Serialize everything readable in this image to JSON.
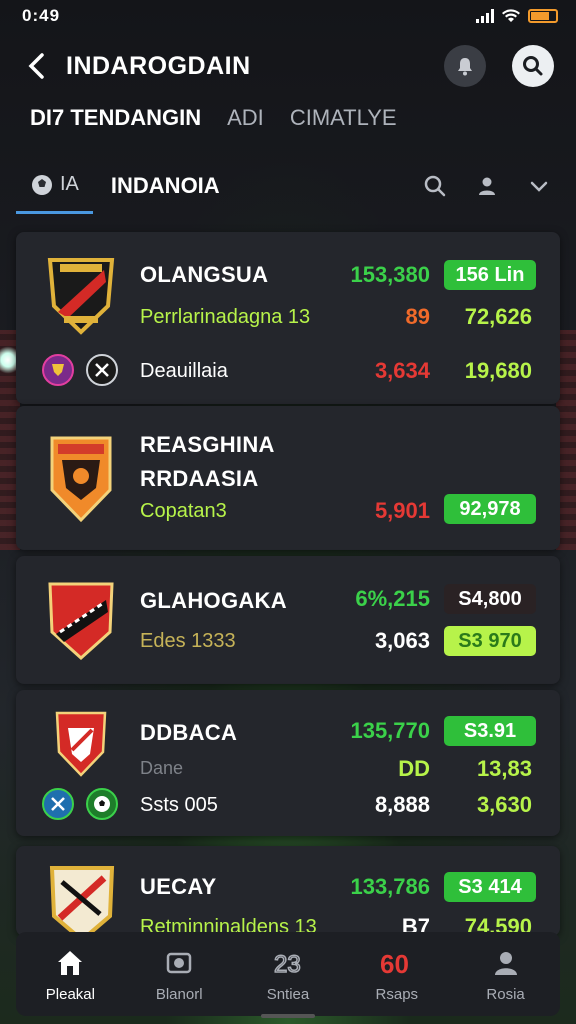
{
  "status_bar": {
    "time": "0:49"
  },
  "header": {
    "title": "INDAROGDAIN"
  },
  "top_tabs": [
    {
      "label": "DI7 TENDANGIN",
      "active": true
    },
    {
      "label": "ADI",
      "active": false
    },
    {
      "label": "CIMATLYE",
      "active": false
    }
  ],
  "sub_bar": {
    "filter_label": "IA",
    "region": "INDANOIA"
  },
  "cards": [
    {
      "team": "OLANGSUA",
      "sub": "Perrlarinadagna 13",
      "value1": "153,380",
      "pill1": "156 Lin",
      "value2": "89",
      "value3": "72,626",
      "extra_label": "Deauillaia",
      "extra_value1": "3,634",
      "extra_value2": "19,680"
    },
    {
      "team_line1": "REASGHINA",
      "team_line2": "RRDAASIA",
      "sub": "Copatan3",
      "value1": "5,901",
      "pill1": "92,978"
    },
    {
      "team": "GLAHOGAKA",
      "sub": "Edes 1333",
      "value1": "6%,215",
      "pill1": "S4,800",
      "value2": "3,063",
      "pill2": "S3 970"
    },
    {
      "team": "DDBACA",
      "sub_faint": "Dane",
      "value1": "135,770",
      "pill1": "S3.91",
      "value2": "DD",
      "value3": "13,83",
      "extra_label": "Ssts 005",
      "extra_value1": "8,888",
      "extra_value2": "3,630"
    },
    {
      "team": "UECAY",
      "sub": "Retminninaldens 13",
      "value1": "133,786",
      "pill1": "S3 414",
      "value2": "B7",
      "value3": "74,590"
    }
  ],
  "bottom_nav": [
    {
      "label": "Pleakal",
      "icon": "home-icon",
      "active": true
    },
    {
      "label": "Blanorl",
      "icon": "cube-icon",
      "active": false
    },
    {
      "label": "Sntiea",
      "icon": "stats-icon",
      "active": false
    },
    {
      "label": "Rsaps",
      "icon": "score-icon",
      "active": false
    },
    {
      "label": "Rosia",
      "icon": "profile-icon",
      "active": false
    }
  ],
  "colors": {
    "green": "#3bd14a",
    "lime": "#b7f34a",
    "red": "#e53935",
    "pill_green": "#2fbf3a",
    "accent_blue": "#4a98e0",
    "battery": "#f29a2c"
  }
}
